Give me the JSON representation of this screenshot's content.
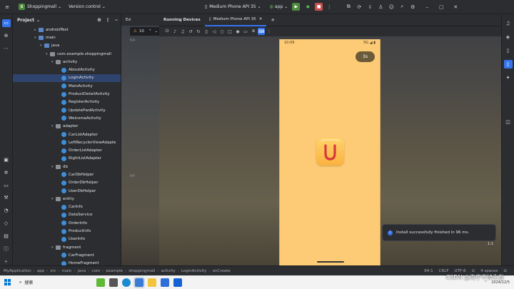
{
  "titlebar": {
    "project_badge": "S",
    "project_name": "Shoppingmall",
    "vcs_label": "Version control",
    "device_label": "Medium Phone API 35",
    "run_config": "app"
  },
  "project_panel": {
    "title": "Project",
    "tree": [
      {
        "label": "androidTest",
        "kind": "folder",
        "depth": 4,
        "arrow": "▸"
      },
      {
        "label": "main",
        "kind": "folder",
        "depth": 4,
        "arrow": "▾"
      },
      {
        "label": "java",
        "kind": "folder",
        "depth": 5,
        "arrow": "▾"
      },
      {
        "label": "com.example.shoppingmall",
        "kind": "package",
        "depth": 6,
        "arrow": "▾"
      },
      {
        "label": "activity",
        "kind": "package",
        "depth": 7,
        "arrow": "▾"
      },
      {
        "label": "AboutActivity",
        "kind": "class",
        "depth": 8,
        "arrow": ""
      },
      {
        "label": "LoginActivity",
        "kind": "class",
        "depth": 8,
        "arrow": ""
      },
      {
        "label": "MainActivity",
        "kind": "class",
        "depth": 8,
        "arrow": ""
      },
      {
        "label": "ProductDetailActivity",
        "kind": "class",
        "depth": 8,
        "arrow": ""
      },
      {
        "label": "RegisterActivity",
        "kind": "class",
        "depth": 8,
        "arrow": ""
      },
      {
        "label": "UpdatePwdActivity",
        "kind": "class",
        "depth": 8,
        "arrow": ""
      },
      {
        "label": "WelcomeActivity",
        "kind": "class",
        "depth": 8,
        "arrow": ""
      },
      {
        "label": "adapter",
        "kind": "package",
        "depth": 7,
        "arrow": "▾"
      },
      {
        "label": "CarListAdapter",
        "kind": "class",
        "depth": 8,
        "arrow": ""
      },
      {
        "label": "LeftRecyclerViewAdapte",
        "kind": "class",
        "depth": 8,
        "arrow": ""
      },
      {
        "label": "OrderListAdapter",
        "kind": "class",
        "depth": 8,
        "arrow": ""
      },
      {
        "label": "RightListAdapter",
        "kind": "class",
        "depth": 8,
        "arrow": ""
      },
      {
        "label": "db",
        "kind": "package",
        "depth": 7,
        "arrow": "▾"
      },
      {
        "label": "CarDbHelper",
        "kind": "class",
        "depth": 8,
        "arrow": ""
      },
      {
        "label": "OrderDbHelper",
        "kind": "class",
        "depth": 8,
        "arrow": ""
      },
      {
        "label": "UserDbHelper",
        "kind": "class",
        "depth": 8,
        "arrow": ""
      },
      {
        "label": "entity",
        "kind": "package",
        "depth": 7,
        "arrow": "▾"
      },
      {
        "label": "CarInfo",
        "kind": "class",
        "depth": 8,
        "arrow": ""
      },
      {
        "label": "DataService",
        "kind": "class",
        "depth": 8,
        "arrow": ""
      },
      {
        "label": "OrderInfo",
        "kind": "class",
        "depth": 8,
        "arrow": ""
      },
      {
        "label": "ProductInfo",
        "kind": "class",
        "depth": 8,
        "arrow": ""
      },
      {
        "label": "UserInfo",
        "kind": "class",
        "depth": 8,
        "arrow": ""
      },
      {
        "label": "fragment",
        "kind": "package",
        "depth": 7,
        "arrow": "▾"
      },
      {
        "label": "CarFragment",
        "kind": "class",
        "depth": 8,
        "arrow": ""
      },
      {
        "label": "HomeFragment",
        "kind": "class",
        "depth": 8,
        "arrow": ""
      }
    ]
  },
  "editor": {
    "tab_label": "Ed",
    "warning_count": "10",
    "line_numbers": [
      "54",
      "",
      "",
      "",
      "",
      "",
      "",
      "",
      "",
      "",
      "",
      "",
      "84",
      "",
      "",
      "",
      "",
      "",
      "",
      "",
      ""
    ]
  },
  "devices": {
    "tab_running": "Running Devices",
    "tab_device": "Medium Phone API 35",
    "phone": {
      "time": "10:09",
      "signal": "5G",
      "skip_label": "3s"
    }
  },
  "notification": {
    "text": "Install successfully finished in 96 ms."
  },
  "ratio_label": "1:1",
  "breadcrumb": [
    "MyApplication",
    "app",
    "src",
    "main",
    "java",
    "com",
    "example",
    "shoppingmall",
    "activity",
    "LoginActivity",
    "onCreate"
  ],
  "status_right": {
    "position": "84:1",
    "line_sep": "CRLF",
    "encoding": "UTF-8",
    "indent": "4 spaces"
  },
  "taskbar": {
    "search_label": "搜索",
    "clock_date": "2024/12/5"
  },
  "watermark": "CSDN @海宁不掉头发",
  "colors": {
    "accent": "#3574f0",
    "run_green": "#4e8a3e",
    "stop_red": "#c94f4f",
    "phone_bg": "#fdcb75"
  }
}
